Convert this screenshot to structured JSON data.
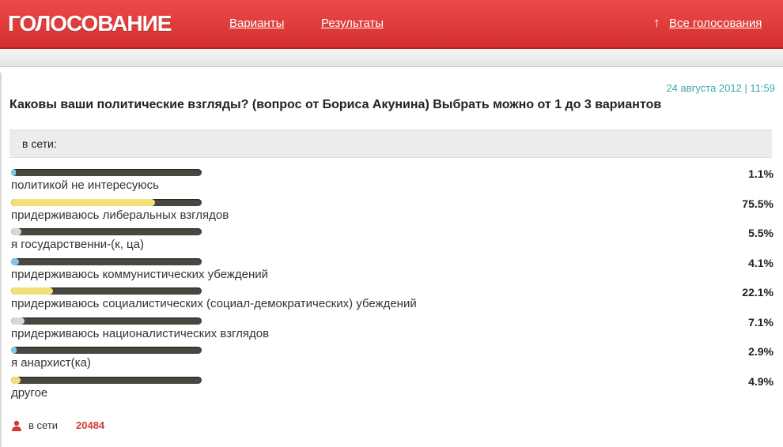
{
  "header": {
    "logo": "ГОЛОСОВАНИЕ",
    "nav_variants": "Варианты",
    "nav_results": "Результаты",
    "up_arrow": "↑",
    "nav_all": "Все голосования"
  },
  "colors": {
    "header_red": "#e03a3a",
    "fill_yellow": "#f4e07a",
    "fill_blue": "#7fc8ea",
    "fill_gray": "#d8d8d8",
    "timestamp": "#3aa8a8",
    "count_red": "#d43a3a"
  },
  "poll": {
    "timestamp": "24 августа 2012 | 11:59",
    "question": "Каковы ваши политические взгляды? (вопрос от Бориса Акунина) Выбрать можно от 1 до 3 вариантов",
    "group_label": "в сети:",
    "options": [
      {
        "label": "политикой не интересуюсь",
        "percent": "1.1%",
        "value": 1.1,
        "color": "#7fc8ea"
      },
      {
        "label": "придерживаюсь либеральных взглядов",
        "percent": "75.5%",
        "value": 75.5,
        "color": "#f4e07a"
      },
      {
        "label": "я государственни-(к, ца)",
        "percent": "5.5%",
        "value": 5.5,
        "color": "#d8d8d8"
      },
      {
        "label": "придерживаюсь коммунистических убеждений",
        "percent": "4.1%",
        "value": 4.1,
        "color": "#7fc8ea"
      },
      {
        "label": "придерживаюсь социалистических (социал-демократических) убеждений",
        "percent": "22.1%",
        "value": 22.1,
        "color": "#f4e07a"
      },
      {
        "label": "придерживаюсь националистических взглядов",
        "percent": "7.1%",
        "value": 7.1,
        "color": "#d8d8d8"
      },
      {
        "label": "я анархист(ка)",
        "percent": "2.9%",
        "value": 2.9,
        "color": "#7fc8ea"
      },
      {
        "label": "другое",
        "percent": "4.9%",
        "value": 4.9,
        "color": "#f4e07a"
      }
    ]
  },
  "footer": {
    "icon": "user-icon",
    "label": "в сети",
    "count": "20484"
  }
}
